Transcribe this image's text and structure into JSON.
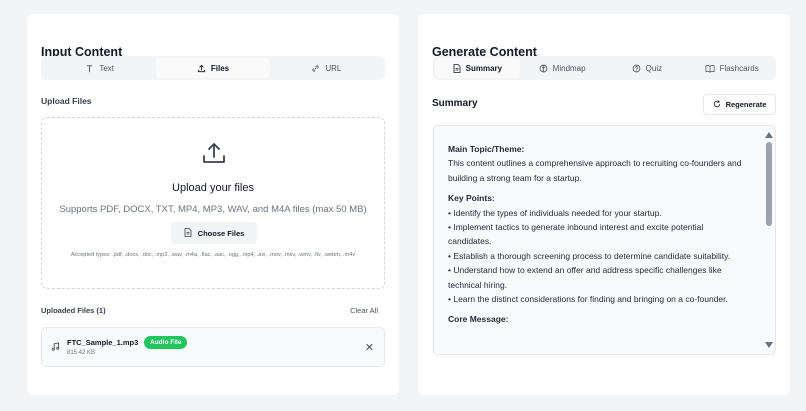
{
  "input": {
    "title": "Input Content",
    "tabs": [
      {
        "label": "Text",
        "icon": "text-icon",
        "active": false
      },
      {
        "label": "Files",
        "icon": "upload-icon",
        "active": true
      },
      {
        "label": "URL",
        "icon": "link-icon",
        "active": false
      }
    ],
    "upload_label": "Upload Files",
    "dropzone": {
      "title": "Upload your files",
      "subtitle": "Supports PDF, DOCX, TXT, MP4, MP3, WAV, and M4A files (max 50 MB)",
      "button": "Choose Files",
      "accepted": "Accepted types: .pdf, .docx, .doc, .mp3, .wav, .m4a, .flac, .aac, .ogg, .mp4, .avi, .mov, .mkv, .wmv, .flv, .webm, .m4v"
    },
    "uploaded": {
      "label": "Uploaded Files (1)",
      "clear": "Clear All",
      "files": [
        {
          "name": "FTC_Sample_1.mp3",
          "size": "815.42 KB",
          "badge": "Audio File"
        }
      ]
    }
  },
  "generate": {
    "title": "Generate Content",
    "tabs": [
      {
        "label": "Summary",
        "icon": "document-icon",
        "active": true
      },
      {
        "label": "Mindmap",
        "icon": "mindmap-icon",
        "active": false
      },
      {
        "label": "Quiz",
        "icon": "quiz-icon",
        "active": false
      },
      {
        "label": "Flashcards",
        "icon": "book-icon",
        "active": false
      }
    ],
    "section_label": "Summary",
    "regenerate": "Regenerate",
    "summary": {
      "main_heading": "Main Topic/Theme:",
      "main_text": "This content outlines a comprehensive approach to recruiting co-founders and building a strong team for a startup.",
      "points_heading": "Key Points:",
      "points": [
        "• Identify the types of individuals needed for your startup.",
        "• Implement tactics to generate inbound interest and excite potential candidates.",
        "• Establish a thorough screening process to determine candidate suitability.",
        "• Understand how to extend an offer and address specific challenges like technical hiring.",
        "• Learn the distinct considerations for finding and bringing on a co-founder."
      ],
      "core_heading": "Core Message:"
    }
  },
  "colors": {
    "background": "#f3f4f6",
    "badge": "#22c55e"
  }
}
